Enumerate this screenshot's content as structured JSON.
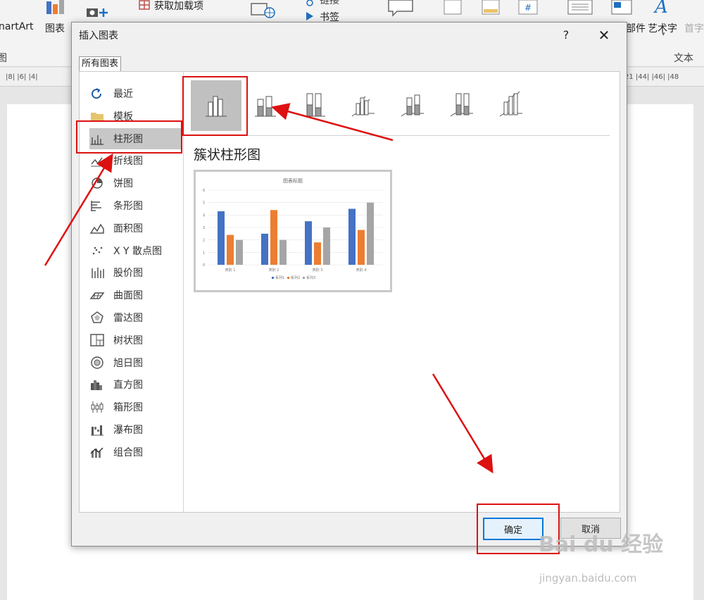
{
  "ribbon": {
    "smartart": "nartArt",
    "chart": "图表",
    "addins": "获取加载项",
    "bookmark": "书签",
    "link": "链接",
    "parts": "部件",
    "wordart": "艺术字",
    "dropcap": "首字",
    "group_text": "文本",
    "group_left": "图"
  },
  "ruler": {
    "left": "|8|  |6|  |4|",
    "right": "21  |44|  |46|  |48"
  },
  "dialog": {
    "title": "插入图表",
    "help": "?",
    "close": "✕",
    "tab_label": "所有图表",
    "categories": [
      {
        "label": "最近",
        "icon": "recent-icon"
      },
      {
        "label": "模板",
        "icon": "folder-icon"
      },
      {
        "label": "柱形图",
        "icon": "column-chart-icon"
      },
      {
        "label": "折线图",
        "icon": "line-chart-icon"
      },
      {
        "label": "饼图",
        "icon": "pie-chart-icon"
      },
      {
        "label": "条形图",
        "icon": "bar-chart-icon"
      },
      {
        "label": "面积图",
        "icon": "area-chart-icon"
      },
      {
        "label": "X Y 散点图",
        "icon": "scatter-chart-icon"
      },
      {
        "label": "股价图",
        "icon": "stock-chart-icon"
      },
      {
        "label": "曲面图",
        "icon": "surface-chart-icon"
      },
      {
        "label": "雷达图",
        "icon": "radar-chart-icon"
      },
      {
        "label": "树状图",
        "icon": "treemap-chart-icon"
      },
      {
        "label": "旭日图",
        "icon": "sunburst-chart-icon"
      },
      {
        "label": "直方图",
        "icon": "histogram-chart-icon"
      },
      {
        "label": "箱形图",
        "icon": "box-whisker-chart-icon"
      },
      {
        "label": "瀑布图",
        "icon": "waterfall-chart-icon"
      },
      {
        "label": "组合图",
        "icon": "combo-chart-icon"
      }
    ],
    "selected_category": "柱形图",
    "subtypes": [
      "clustered-column-icon",
      "stacked-column-icon",
      "percent-stacked-column-icon",
      "3d-clustered-column-icon",
      "3d-stacked-column-icon",
      "3d-percent-stacked-column-icon",
      "3d-column-icon"
    ],
    "selected_subtype_title": "簇状柱形图",
    "ok": "确定",
    "cancel": "取消"
  },
  "watermark": {
    "brand": "Bai du 经验",
    "url": "jingyan.baidu.com"
  },
  "colors": {
    "series1": "#4472c4",
    "series2": "#ed7d31",
    "series3": "#a5a5a5",
    "annotation": "#d11111"
  },
  "chart_data": {
    "type": "bar",
    "title": "图表标题",
    "categories": [
      "类别 1",
      "类别 2",
      "类别 3",
      "类别 4"
    ],
    "series": [
      {
        "name": "系列1",
        "values": [
          4.3,
          2.5,
          3.5,
          4.5
        ]
      },
      {
        "name": "系列2",
        "values": [
          2.4,
          4.4,
          1.8,
          2.8
        ]
      },
      {
        "name": "系列3",
        "values": [
          2,
          2,
          3,
          5
        ]
      }
    ],
    "ylim": [
      0,
      6
    ],
    "yticks": [
      0,
      1,
      2,
      3,
      4,
      5,
      6
    ],
    "legend": "bottom",
    "grid": true
  }
}
